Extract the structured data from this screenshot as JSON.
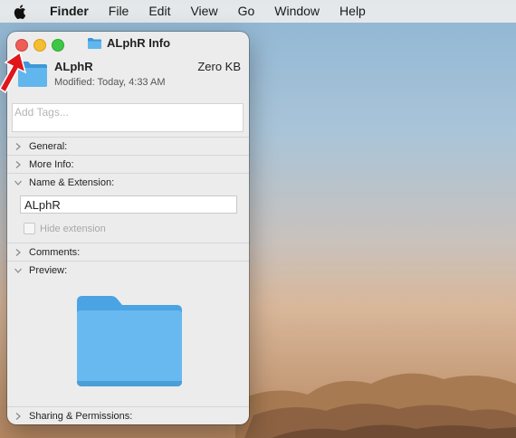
{
  "menubar": {
    "apple_icon": "apple-logo-icon",
    "items": [
      "Finder",
      "File",
      "Edit",
      "View",
      "Go",
      "Window",
      "Help"
    ]
  },
  "window": {
    "title": "ALphR Info",
    "traffic_lights": {
      "close": "#ee5d56",
      "minimize": "#f5bd30",
      "zoom": "#3ec745"
    }
  },
  "header": {
    "name": "ALphR",
    "size": "Zero KB",
    "modified": "Modified: Today, 4:33 AM",
    "icon": "folder-icon"
  },
  "tags": {
    "placeholder": "Add Tags..."
  },
  "sections": {
    "general": "General:",
    "more_info": "More Info:",
    "name_extension": "Name & Extension:",
    "comments": "Comments:",
    "preview": "Preview:",
    "sharing": "Sharing & Permissions:"
  },
  "name_extension": {
    "value": "ALphR",
    "hide_extension_label": "Hide extension",
    "hide_extension_checked": false
  },
  "colors": {
    "folder_blue": "#5ab0ea",
    "annotation_arrow": "#e0161b"
  }
}
